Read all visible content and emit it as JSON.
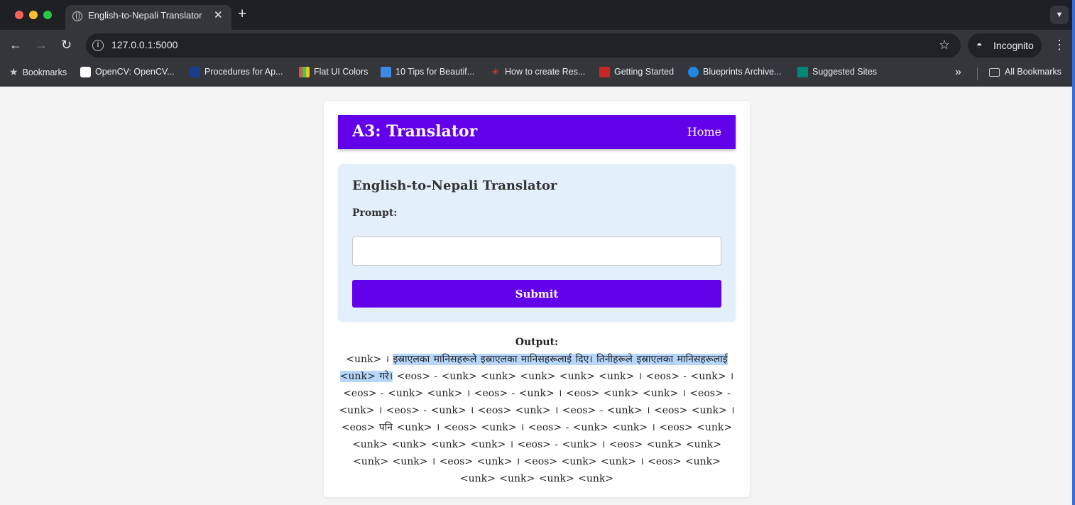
{
  "browser": {
    "tab_title": "English-to-Nepali Translator",
    "url": "127.0.0.1:5000",
    "incognito_label": "Incognito",
    "bookmarks": [
      {
        "label": "Bookmarks",
        "icon": "star-icon"
      },
      {
        "label": "OpenCV: OpenCV...",
        "icon": "opencv-icon"
      },
      {
        "label": "Procedures for Ap...",
        "icon": "adb-icon"
      },
      {
        "label": "Flat UI Colors",
        "icon": "flat-ui-icon"
      },
      {
        "label": "10 Tips for Beautif...",
        "icon": "tips-icon"
      },
      {
        "label": "How to create Res...",
        "icon": "asterisk-icon"
      },
      {
        "label": "Getting Started",
        "icon": "getting-started-icon"
      },
      {
        "label": "Blueprints Archive...",
        "icon": "blueprints-icon"
      },
      {
        "label": "Suggested Sites",
        "icon": "bing-icon"
      }
    ],
    "all_bookmarks_label": "All Bookmarks"
  },
  "app": {
    "title": "A3: Translator",
    "nav_home": "Home",
    "accent_color": "#6200ea"
  },
  "form": {
    "heading": "English-to-Nepali Translator",
    "prompt_label": "Prompt:",
    "prompt_value": "",
    "submit_label": "Submit"
  },
  "output": {
    "label": "Output:",
    "text_before_selection": "<unk> । ",
    "text_selected": "इस्राएलका मानिसहरूले इस्राएलका मानिसहरूलाई दिए। तिनीहरूले इस्राएलका मानिसहरूलाई <unk> गरे।",
    "text_after_selection": " <eos> - <unk> <unk> <unk> <unk> <unk> । <eos> - <unk> । <eos> - <unk> <unk> । <eos> - <unk> । <eos> <unk> <unk> । <eos> - <unk> । <eos> - <unk> । <eos> <unk> । <eos> - <unk> । <eos> <unk> । <eos> पनि <unk> । <eos> <unk> । <eos> - <unk> <unk> । <eos> <unk> <unk> <unk> <unk> <unk> । <eos> - <unk> । <eos> <unk> <unk> <unk> <unk> । <eos> <unk> । <eos> <unk> <unk> । <eos> <unk> <unk> <unk> <unk> <unk>"
  }
}
